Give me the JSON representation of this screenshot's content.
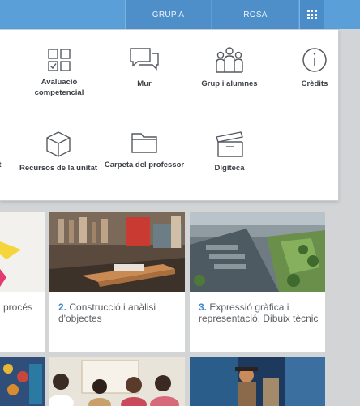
{
  "header": {
    "group_label": "GRUP A",
    "class_label": "ROSA",
    "apps_icon": "grid-apps-icon"
  },
  "menu": {
    "items": [
      {
        "label": "Avaluació competencial",
        "icon": "assessment-checklist-icon"
      },
      {
        "label": "Mur",
        "icon": "chat-bubbles-icon"
      },
      {
        "label": "Grup i alumnes",
        "icon": "people-group-icon"
      },
      {
        "label": "Crèdits",
        "icon": "info-circle-icon"
      },
      {
        "label": "Recursos de la unitat",
        "icon": "cube-icon"
      },
      {
        "label": "Carpeta del professor",
        "icon": "folder-icon"
      },
      {
        "label": "Digiteca",
        "icon": "archive-box-icon"
      }
    ],
    "cut_label": "t"
  },
  "cards": [
    {
      "number": "",
      "title": "procés"
    },
    {
      "number": "2.",
      "title": "Construcció i anàlisi d'objectes"
    },
    {
      "number": "3.",
      "title": "Expressió gràfica i representació. Dibuix tècnic"
    }
  ],
  "colors": {
    "topbar": "#5a9fd8",
    "accent_number": "#3f86c8",
    "page_background": "#d3d4d6"
  }
}
